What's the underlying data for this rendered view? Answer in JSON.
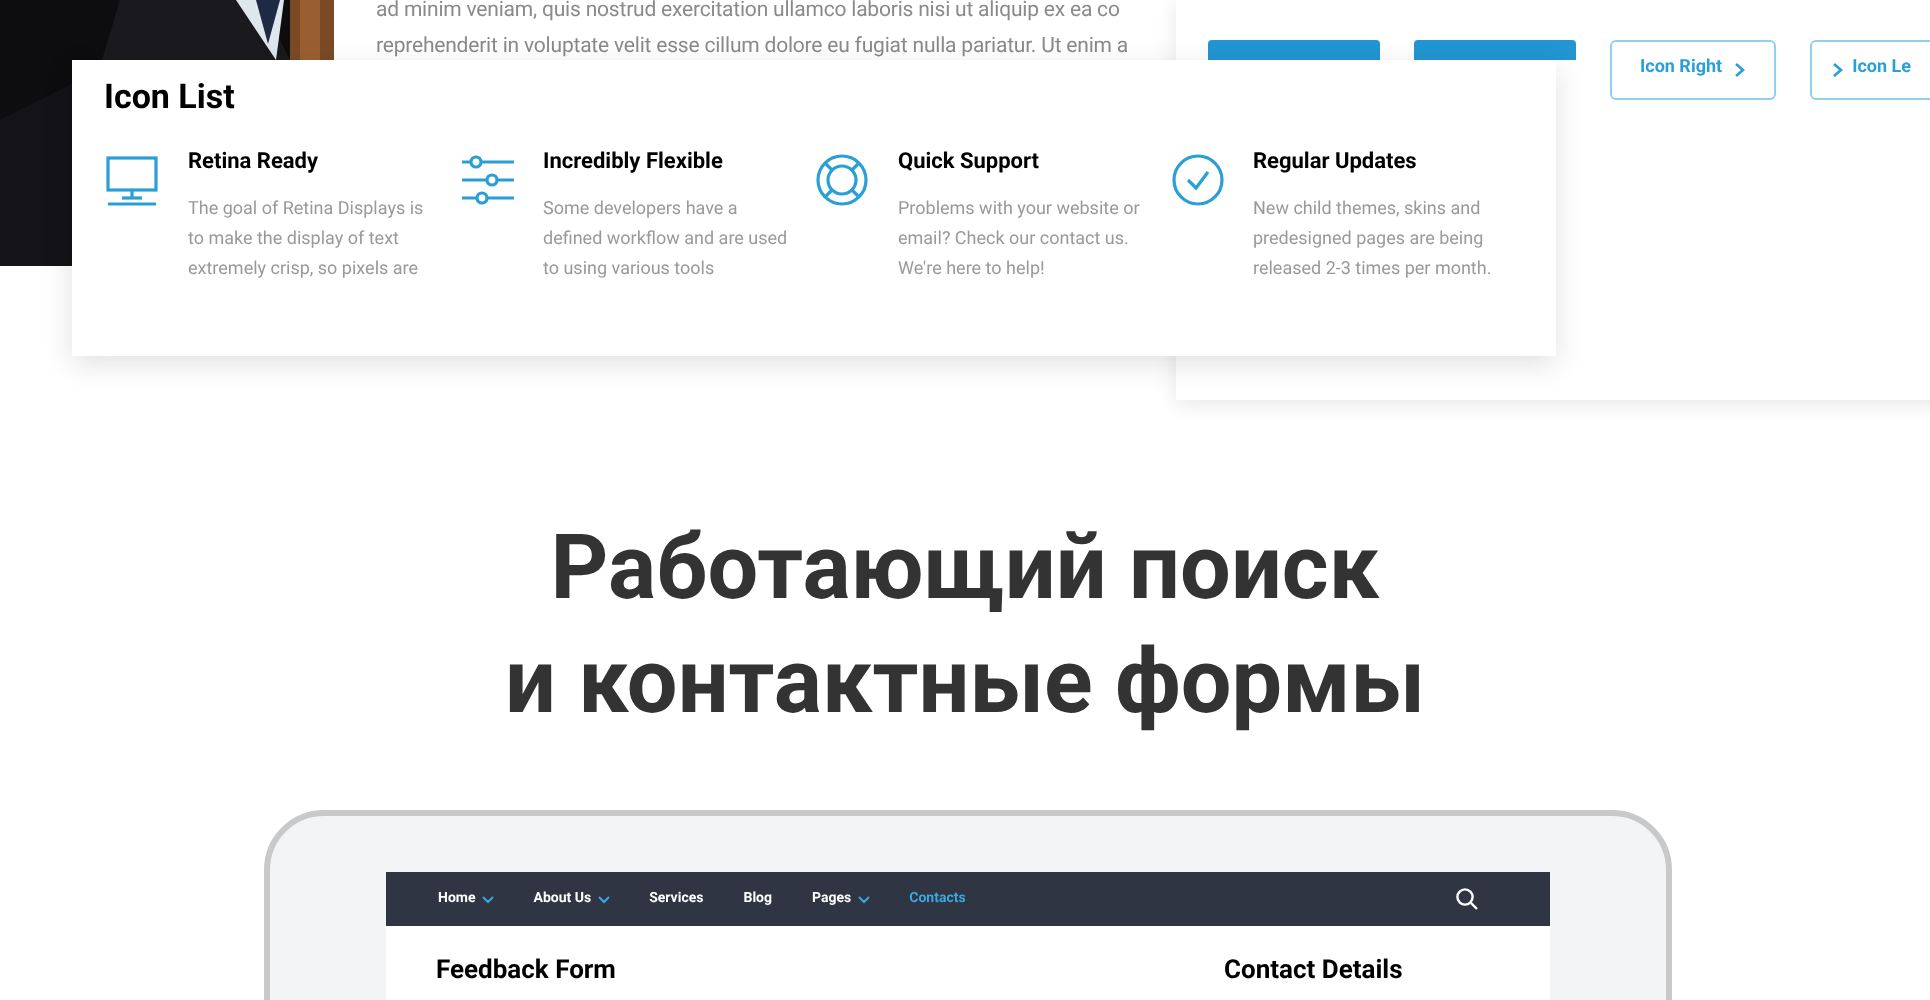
{
  "background_text": {
    "lines": [
      "ad minim veniam, quis nostrud exercitation ullamco laboris nisi ut aliquip ex ea co",
      "reprehenderit in voluptate velit esse cillum dolore eu fugiat nulla pariatur. Ut enim a"
    ]
  },
  "buttons_panel": {
    "buttons": [
      {
        "kind": "filled"
      },
      {
        "kind": "filled"
      },
      {
        "kind": "icon_right",
        "label": "Icon Right"
      },
      {
        "kind": "icon_left",
        "label": "Icon Le"
      }
    ]
  },
  "icon_list": {
    "title": "Icon List",
    "items": [
      {
        "kind": "monitor",
        "title": "Retina Ready",
        "lines": [
          "The goal of Retina Displays is",
          "to make the display of text",
          "extremely crisp, so pixels are"
        ]
      },
      {
        "kind": "sliders",
        "title": "Incredibly Flexible",
        "lines": [
          "Some developers have a",
          "defined workflow and are used",
          "to using various tools"
        ]
      },
      {
        "kind": "lifebuoy",
        "title": "Quick Support",
        "lines": [
          "Problems with your website or",
          "email? Check our contact us.",
          "We're here to help!"
        ]
      },
      {
        "kind": "check",
        "title": "Regular Updates",
        "lines": [
          "New child themes, skins and",
          "predesigned pages are being",
          "released 2-3 times per month."
        ]
      }
    ]
  },
  "headline": {
    "lines": [
      "Работающий поиск",
      "и контактные формы"
    ]
  },
  "tablet": {
    "nav": [
      {
        "label": "Home",
        "dropdown": true,
        "selected": false
      },
      {
        "label": "About Us",
        "dropdown": true,
        "selected": false
      },
      {
        "label": "Services",
        "dropdown": false,
        "selected": false
      },
      {
        "label": "Blog",
        "dropdown": false,
        "selected": false
      },
      {
        "label": "Pages",
        "dropdown": true,
        "selected": false
      },
      {
        "label": "Contacts",
        "dropdown": false,
        "selected": true
      }
    ],
    "headings": [
      "Feedback Form",
      "Contact Details"
    ]
  }
}
